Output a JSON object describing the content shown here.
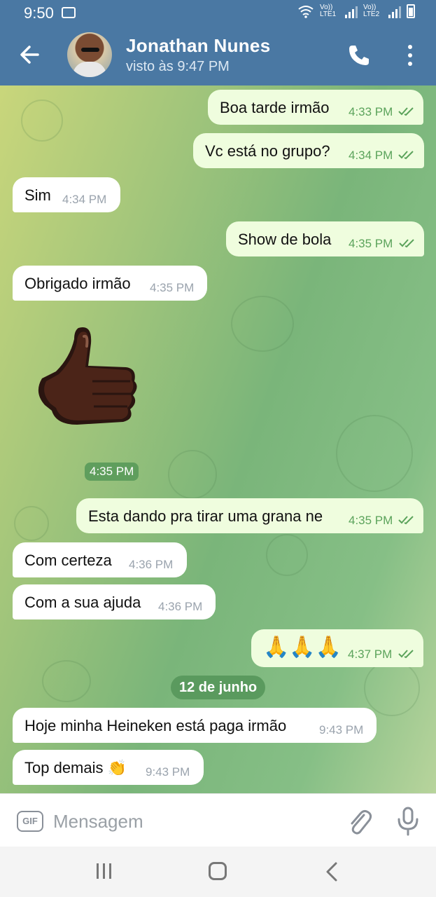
{
  "status_bar": {
    "time": "9:50",
    "sim1": "Vo)) LTE1",
    "sim2": "Vo)) LTE2"
  },
  "header": {
    "contact_name": "Jonathan Nunes",
    "last_seen": "visto às 9:47 PM"
  },
  "messages": [
    {
      "text": "Boa tarde irmão",
      "time": "4:33 PM",
      "direction": "out",
      "read": true
    },
    {
      "text": "Vc está no grupo?",
      "time": "4:34 PM",
      "direction": "out",
      "read": true
    },
    {
      "text": "Sim",
      "time": "4:34 PM",
      "direction": "in"
    },
    {
      "text": "Show de bola",
      "time": "4:35 PM",
      "direction": "out",
      "read": true
    },
    {
      "text": "Obrigado irmão",
      "time": "4:35 PM",
      "direction": "in"
    },
    {
      "sticker": "thumbs-up",
      "time": "4:35 PM",
      "direction": "in"
    },
    {
      "text": "Esta dando pra tirar uma grana ne",
      "time": "4:35 PM",
      "direction": "out",
      "read": true
    },
    {
      "text": "Com certeza",
      "time": "4:36 PM",
      "direction": "in"
    },
    {
      "text": "Com a sua ajuda",
      "time": "4:36 PM",
      "direction": "in"
    },
    {
      "emoji": "🙏🙏🙏",
      "time": "4:37 PM",
      "direction": "out",
      "read": true
    },
    {
      "text": "Hoje minha Heineken está paga irmão",
      "time": "9:43 PM",
      "direction": "in"
    },
    {
      "text": "Top demais 👏",
      "time": "9:43 PM",
      "direction": "in"
    }
  ],
  "date_separator": "12 de junho",
  "composer": {
    "gif_label": "GIF",
    "placeholder": "Mensagem"
  },
  "colors": {
    "header": "#4a78a3",
    "outgoing_bubble": "#effdde",
    "incoming_bubble": "#ffffff",
    "read_check": "#5ba35b",
    "date_pill": "#5a9a5e"
  }
}
